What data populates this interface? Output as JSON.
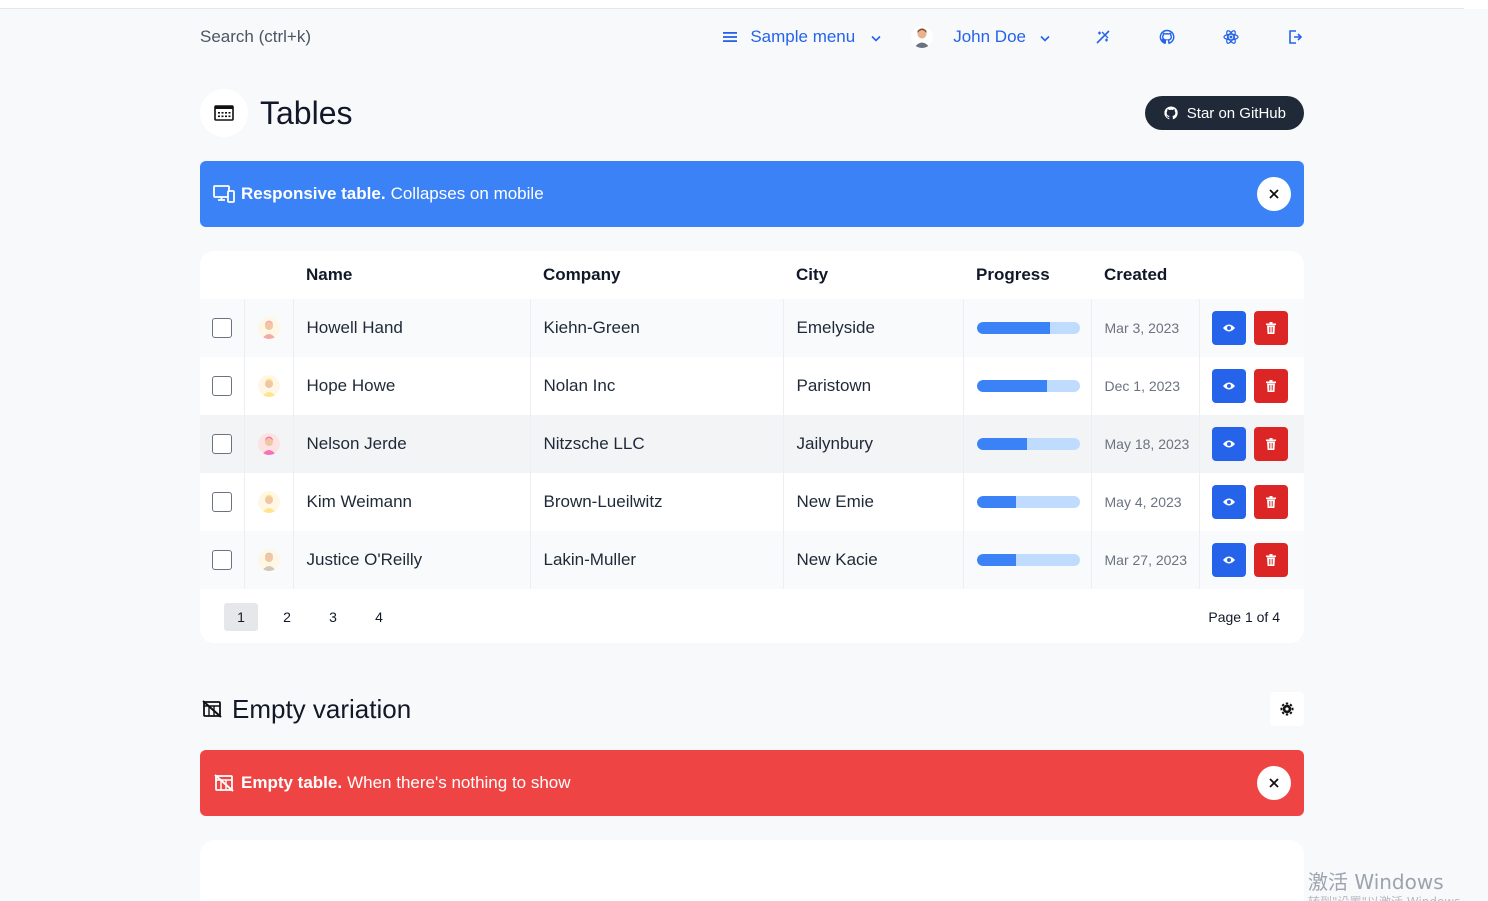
{
  "navbar": {
    "search_placeholder": "Search (ctrl+k)",
    "menu_label": "Sample menu",
    "user_name": "John Doe",
    "icons": [
      "paint-icon",
      "github-icon",
      "react-icon",
      "logout-icon"
    ]
  },
  "page": {
    "title": "Tables",
    "github_button": "Star on GitHub"
  },
  "banner_info": {
    "bold": "Responsive table.",
    "text": "Collapses on mobile",
    "color": "#3b82f6"
  },
  "table": {
    "headers": [
      "",
      "",
      "Name",
      "Company",
      "City",
      "Progress",
      "Created",
      ""
    ],
    "rows": [
      {
        "name": "Howell Hand",
        "company": "Kiehn-Green",
        "city": "Emelyside",
        "progress": 0.71,
        "created": "Mar 3, 2023",
        "avatar": "#f9a8a8"
      },
      {
        "name": "Hope Howe",
        "company": "Nolan Inc",
        "city": "Paristown",
        "progress": 0.68,
        "created": "Dec 1, 2023",
        "avatar": "#fde68a"
      },
      {
        "name": "Nelson Jerde",
        "company": "Nitzsche LLC",
        "city": "Jailynbury",
        "progress": 0.49,
        "created": "May 18, 2023",
        "avatar": "#f472b6"
      },
      {
        "name": "Kim Weimann",
        "company": "Brown-Lueilwitz",
        "city": "New Emie",
        "progress": 0.38,
        "created": "May 4, 2023",
        "avatar": "#fde68a"
      },
      {
        "name": "Justice O'Reilly",
        "company": "Lakin-Muller",
        "city": "New Kacie",
        "progress": 0.38,
        "created": "Mar 27, 2023",
        "avatar": "#d6c4b8"
      }
    ]
  },
  "pagination": {
    "pages": [
      "1",
      "2",
      "3",
      "4"
    ],
    "current": "1",
    "info": "Page 1 of 4"
  },
  "section_empty": {
    "title": "Empty variation"
  },
  "banner_danger": {
    "bold": "Empty table.",
    "text": "When there's nothing to show",
    "color": "#ef4444"
  },
  "watermark": {
    "line1": "激活 Windows",
    "line2": "转到\"设置\"以激活 Windows"
  }
}
